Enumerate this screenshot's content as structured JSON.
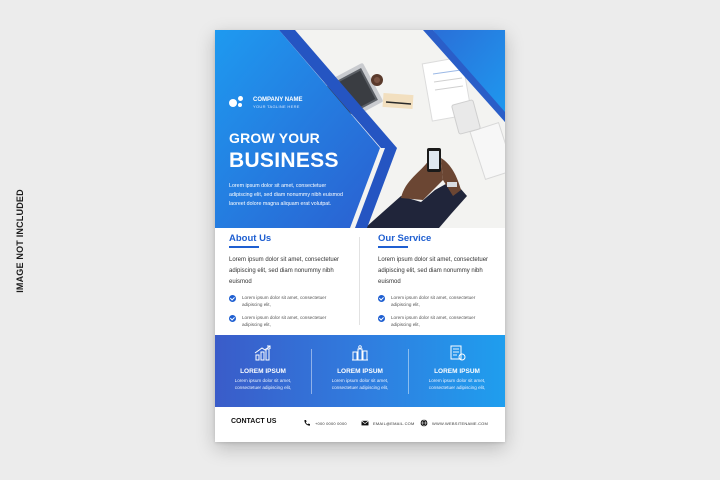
{
  "side_label": "IMAGE NOT INCLUDED",
  "brand": {
    "name": "COMPANY NAME",
    "tagline": "YOUR TAGLINE HERE"
  },
  "hero": {
    "title_line1": "GROW YOUR",
    "title_line2": "BUSINESS",
    "body": "Lorem ipsum dolor sit amet, consectetuer adipiscing elit, sed diam nonummy nibh euismod laoreet dolore magna aliquam erat volutpat."
  },
  "about": {
    "heading": "About Us",
    "paragraph": "Lorem ipsum dolor sit amet, consectetuer adipiscing elit, sed diam nonummy nibh euismod",
    "bullets": [
      "Lorem ipsum dolor sit amet, consectetuer adipiscing elit,",
      "Lorem ipsum dolor sit amet, consectetuer adipiscing elit,"
    ]
  },
  "service": {
    "heading": "Our Service",
    "paragraph": "Lorem ipsum dolor sit amet, consectetuer adipiscing elit, sed diam nonummy nibh euismod",
    "bullets": [
      "Lorem ipsum dolor sit amet, consectetuer adipiscing elit,",
      "Lorem ipsum dolor sit amet, consectetuer adipiscing elit,"
    ]
  },
  "features": [
    {
      "icon": "growth-chart-icon",
      "title": "LOREM IPSUM",
      "desc": "Lorem ipsum dolor sit amet, consectetuer adipiscing elit,"
    },
    {
      "icon": "building-chart-icon",
      "title": "LOREM IPSUM",
      "desc": "Lorem ipsum dolor sit amet, consectetuer adipiscing elit,"
    },
    {
      "icon": "document-stack-icon",
      "title": "LOREM IPSUM",
      "desc": "Lorem ipsum dolor sit amet, consectetuer adipiscing elit,"
    }
  ],
  "contact": {
    "label": "CONTACT US",
    "phone": "+000 0000 0000",
    "email": "EMAIL@EMAIL.COM",
    "website": "WWW.WEBSITENAME.COM"
  },
  "colors": {
    "brand_blue": "#1f5fd1",
    "gradient_start": "#3a5cc9",
    "gradient_end": "#1f9eee",
    "page_background": "#ececec"
  }
}
